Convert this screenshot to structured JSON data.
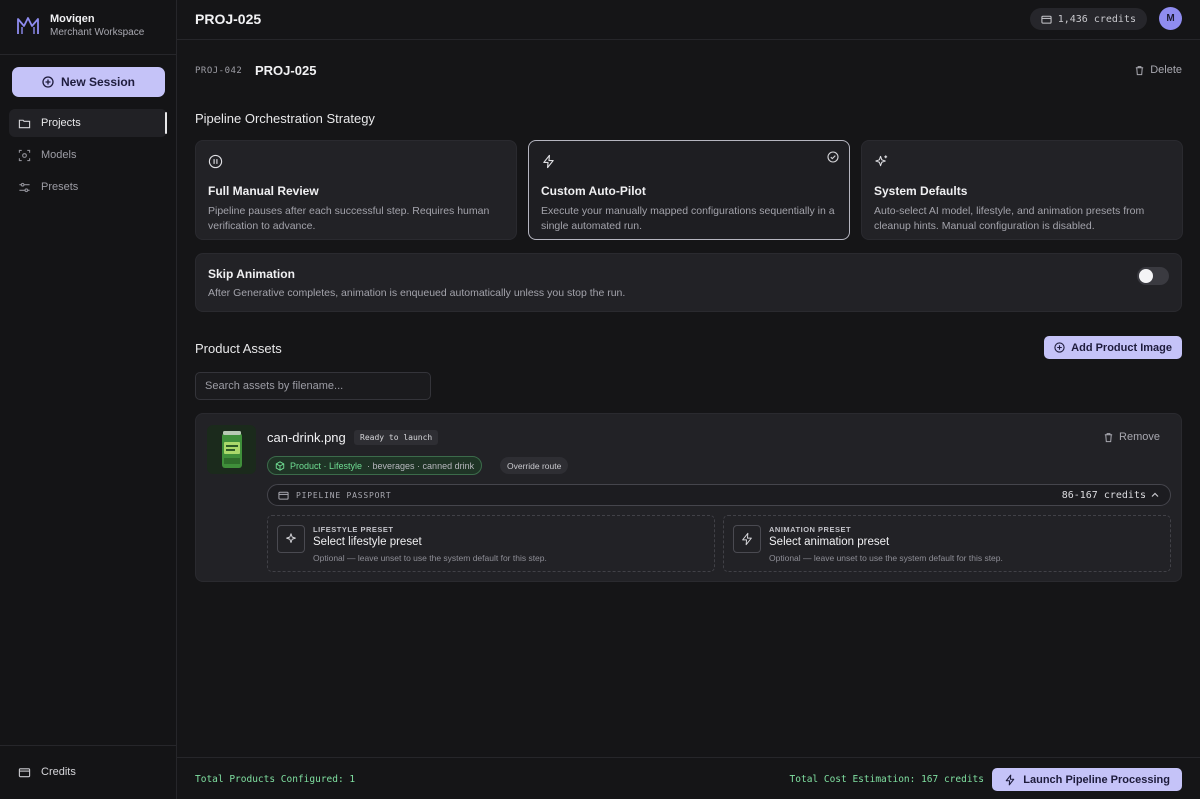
{
  "brand": {
    "name": "Moviqen",
    "subtitle": "Merchant Workspace"
  },
  "sidebar": {
    "new_session": "New Session",
    "items": [
      {
        "label": "Projects",
        "icon": "folder-icon",
        "active": true
      },
      {
        "label": "Models",
        "icon": "scan-face-icon",
        "active": false
      },
      {
        "label": "Presets",
        "icon": "sliders-icon",
        "active": false
      }
    ],
    "bottom": {
      "label": "Credits",
      "icon": "wallet-icon"
    }
  },
  "topbar": {
    "title": "PROJ-025",
    "credits": "1,436 credits",
    "avatar_initial": "M"
  },
  "project": {
    "id": "PROJ-042",
    "name": "PROJ-025",
    "delete_label": "Delete"
  },
  "strategy": {
    "title": "Pipeline Orchestration Strategy",
    "cards": [
      {
        "icon": "pause-icon",
        "title": "Full Manual Review",
        "desc": "Pipeline pauses after each successful step. Requires human verification to advance.",
        "selected": false
      },
      {
        "icon": "zap-icon",
        "title": "Custom Auto-Pilot",
        "desc": "Execute your manually mapped configurations sequentially in a single automated run.",
        "selected": true
      },
      {
        "icon": "sparkles-icon",
        "title": "System Defaults",
        "desc": "Auto-select AI model, lifestyle, and animation presets from cleanup hints. Manual configuration is disabled.",
        "selected": false
      }
    ]
  },
  "skip_animation": {
    "title": "Skip Animation",
    "desc": "After Generative completes, animation is enqueued automatically unless you stop the run.",
    "enabled": false
  },
  "assets": {
    "title": "Product Assets",
    "add_label": "Add Product Image",
    "search_placeholder": "Search assets by filename...",
    "items": [
      {
        "filename": "can-drink.png",
        "status": "Ready to launch",
        "remove_label": "Remove",
        "tag_primary": "Product · Lifestyle",
        "tag_secondary": "· beverages · canned drink",
        "override_label": "Override route",
        "passport_label": "PIPELINE PASSPORT",
        "passport_credits": "86-167 credits",
        "presets": [
          {
            "icon": "sparkles-icon",
            "category": "LIFESTYLE PRESET",
            "title": "Select lifestyle preset",
            "desc": "Optional — leave unset to use the system default for this step."
          },
          {
            "icon": "zap-icon",
            "category": "ANIMATION PRESET",
            "title": "Select animation preset",
            "desc": "Optional — leave unset to use the system default for this step."
          }
        ]
      }
    ]
  },
  "footer": {
    "total_products": "Total Products Configured: 1",
    "total_cost": "Total Cost Estimation: 167 credits",
    "launch_label": "Launch Pipeline Processing"
  },
  "colors": {
    "accent": "#c5c3f8",
    "success": "#7fdfa0",
    "background": "#151517",
    "card": "#222226"
  }
}
